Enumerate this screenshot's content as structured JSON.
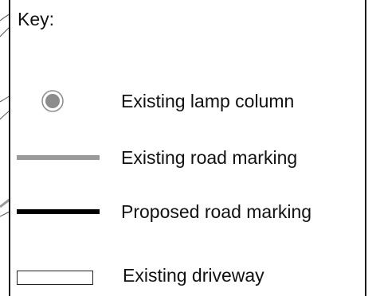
{
  "key": {
    "title": "Key:",
    "items": [
      {
        "symbol": "lamp-column",
        "label": "Existing lamp column",
        "color": "#8c8c8c"
      },
      {
        "symbol": "grey-line",
        "label": "Existing road marking",
        "color": "#9a9a9a"
      },
      {
        "symbol": "black-line",
        "label": "Proposed road marking",
        "color": "#000000"
      },
      {
        "symbol": "rectangle",
        "label": "Existing driveway",
        "color": "#ffffff"
      }
    ]
  }
}
